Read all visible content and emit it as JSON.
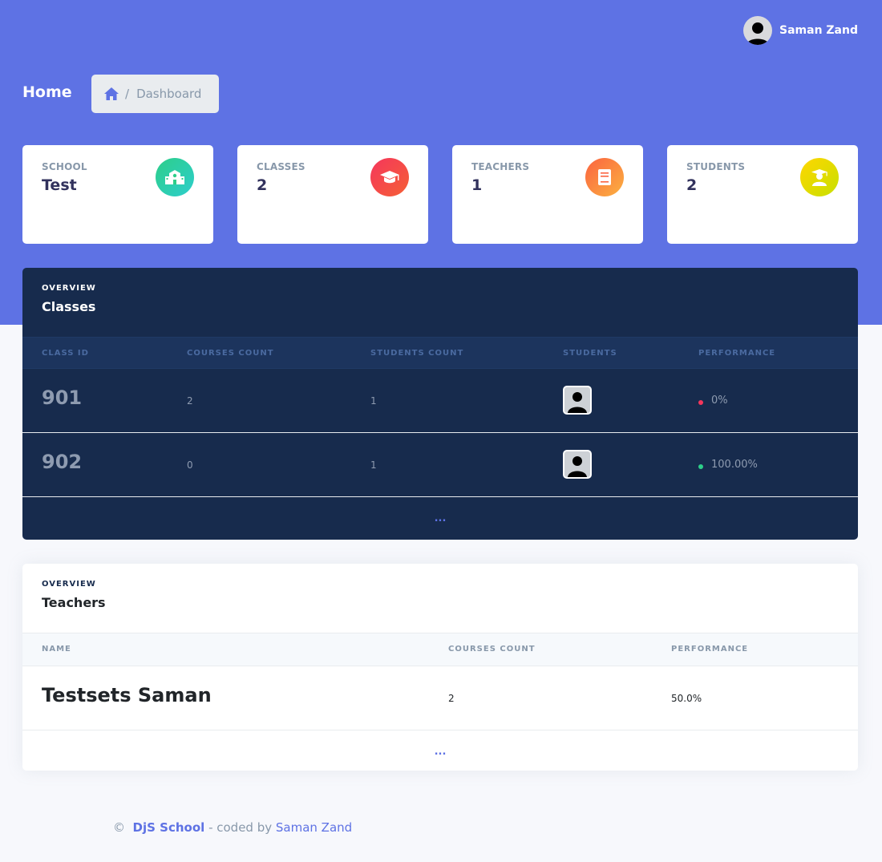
{
  "user": {
    "name": "Saman Zand",
    "avatar_icon": "user-silhouette-icon"
  },
  "header": {
    "title": "Home",
    "breadcrumb": {
      "home_icon": "home-icon",
      "separator": "/",
      "current": "Dashboard"
    }
  },
  "stats": [
    {
      "label": "SCHOOL",
      "value": "Test",
      "icon": "school-icon",
      "color": "#2dce89"
    },
    {
      "label": "CLASSES",
      "value": "2",
      "icon": "graduation-cap-icon",
      "color": "#f5365c"
    },
    {
      "label": "TEACHERS",
      "value": "1",
      "icon": "book-icon",
      "color": "#fb6340"
    },
    {
      "label": "STUDENTS",
      "value": "2",
      "icon": "student-icon",
      "color": "#d5e000"
    }
  ],
  "classes": {
    "eyebrow": "OVERVIEW",
    "title": "Classes",
    "columns": [
      "CLASS ID",
      "COURSES COUNT",
      "STUDENTS COUNT",
      "STUDENTS",
      "PERFORMANCE"
    ],
    "rows": [
      {
        "class_id": "901",
        "courses_count": "2",
        "students_count": "1",
        "performance": "0%",
        "status_color": "#f5365c"
      },
      {
        "class_id": "902",
        "courses_count": "0",
        "students_count": "1",
        "performance": "100.00%",
        "status_color": "#2dce89"
      }
    ],
    "more": "..."
  },
  "teachers": {
    "eyebrow": "OVERVIEW",
    "title": "Teachers",
    "columns": [
      "NAME",
      "COURSES COUNT",
      "PERFORMANCE"
    ],
    "rows": [
      {
        "name": "Testsets Saman",
        "courses_count": "2",
        "performance": "50.0%"
      }
    ],
    "more": "..."
  },
  "footer": {
    "copyright": "©",
    "brand": "DjS School",
    "middle": " - coded by ",
    "author": "Saman Zand"
  }
}
